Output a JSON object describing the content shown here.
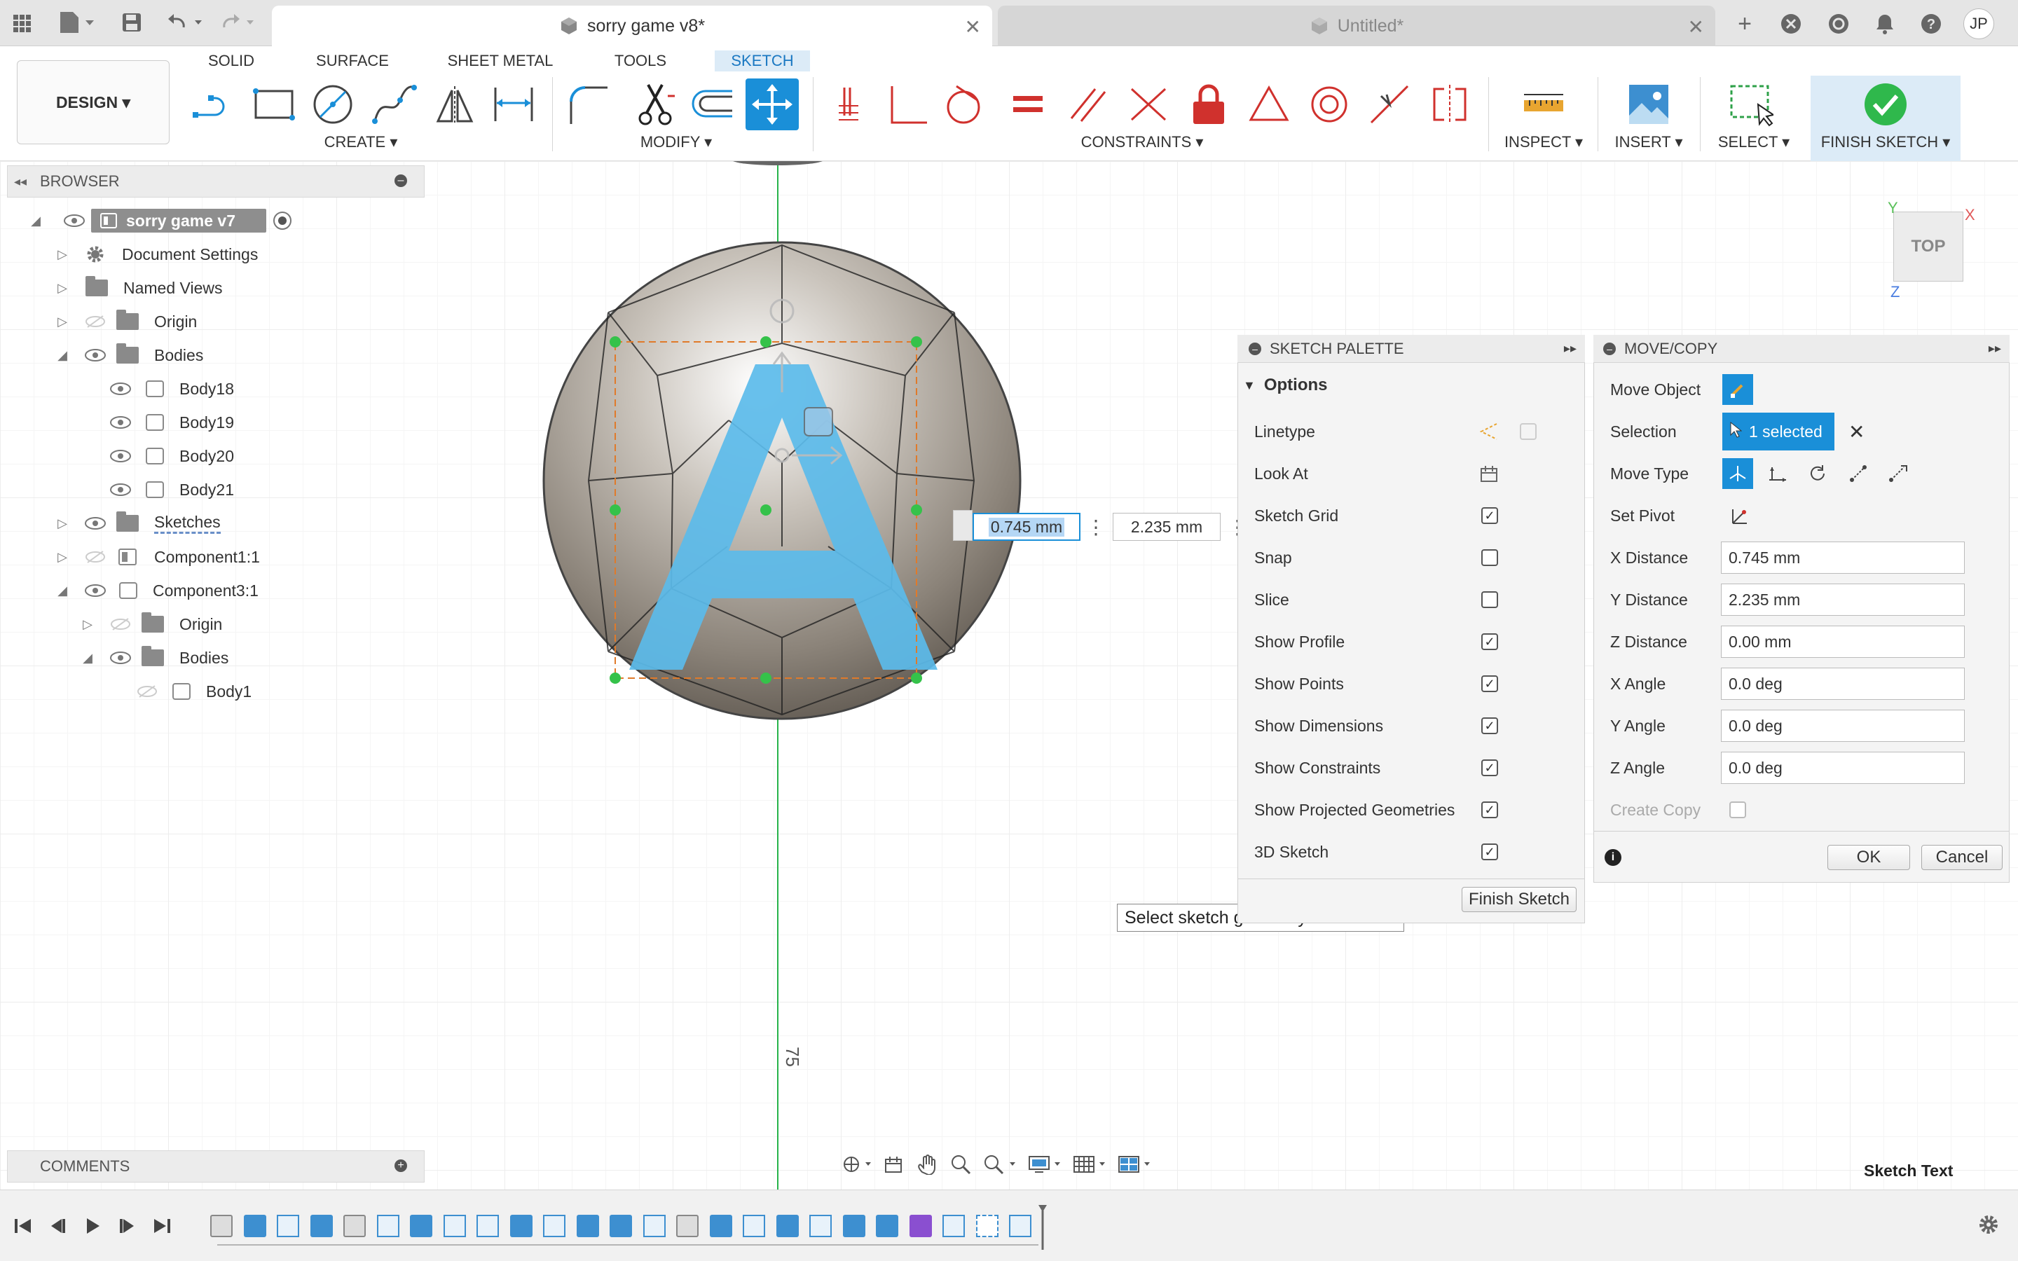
{
  "tabs": {
    "active": "sorry game v8*",
    "inactive": "Untitled*",
    "user_initials": "JP"
  },
  "workspace_tabs": [
    "SOLID",
    "SURFACE",
    "SHEET METAL",
    "TOOLS",
    "SKETCH"
  ],
  "active_workspace_tab": "SKETCH",
  "design_label": "DESIGN ▾",
  "toolbar_groups": {
    "create": "CREATE ▾",
    "modify": "MODIFY ▾",
    "constraints": "CONSTRAINTS ▾",
    "inspect": "INSPECT ▾",
    "insert": "INSERT ▾",
    "select": "SELECT ▾",
    "finish": "FINISH SKETCH ▾"
  },
  "browser": {
    "title": "BROWSER",
    "items": [
      {
        "label": "sorry game v7",
        "level": 0
      },
      {
        "label": "Document Settings",
        "level": 1
      },
      {
        "label": "Named Views",
        "level": 1
      },
      {
        "label": "Origin",
        "level": 1
      },
      {
        "label": "Bodies",
        "level": 1
      },
      {
        "label": "Body18",
        "level": 2
      },
      {
        "label": "Body19",
        "level": 2
      },
      {
        "label": "Body20",
        "level": 2
      },
      {
        "label": "Body21",
        "level": 2
      },
      {
        "label": "Sketches",
        "level": 1
      },
      {
        "label": "Component1:1",
        "level": 1
      },
      {
        "label": "Component3:1",
        "level": 1
      },
      {
        "label": "Origin",
        "level": 2
      },
      {
        "label": "Bodies",
        "level": 2
      },
      {
        "label": "Body1",
        "level": 3
      }
    ]
  },
  "comments_label": "COMMENTS",
  "viewcube_label": "TOP",
  "axis_labels": {
    "x": "X",
    "y": "Y",
    "z": "Z"
  },
  "dimension_inputs": {
    "x": "0.745 mm",
    "y": "2.235 mm"
  },
  "vertical_dimension": "75",
  "tooltip": "Select sketch geometry to move",
  "sketch_palette": {
    "title": "SKETCH PALETTE",
    "section": "Options",
    "rows": [
      {
        "label": "Linetype",
        "type": "icon"
      },
      {
        "label": "Look At",
        "type": "icon"
      },
      {
        "label": "Sketch Grid",
        "type": "check",
        "checked": true
      },
      {
        "label": "Snap",
        "type": "check",
        "checked": false
      },
      {
        "label": "Slice",
        "type": "check",
        "checked": false
      },
      {
        "label": "Show Profile",
        "type": "check",
        "checked": true
      },
      {
        "label": "Show Points",
        "type": "check",
        "checked": true
      },
      {
        "label": "Show Dimensions",
        "type": "check",
        "checked": true
      },
      {
        "label": "Show Constraints",
        "type": "check",
        "checked": true
      },
      {
        "label": "Show Projected Geometries",
        "type": "check",
        "checked": true
      },
      {
        "label": "3D Sketch",
        "type": "check",
        "checked": true
      }
    ],
    "finish_button": "Finish Sketch"
  },
  "move_copy": {
    "title": "MOVE/COPY",
    "move_object_label": "Move Object",
    "selection_label": "Selection",
    "selection_value": "1 selected",
    "move_type_label": "Move Type",
    "set_pivot_label": "Set Pivot",
    "fields": [
      {
        "label": "X Distance",
        "value": "0.745 mm"
      },
      {
        "label": "Y Distance",
        "value": "2.235 mm"
      },
      {
        "label": "Z Distance",
        "value": "0.00 mm"
      },
      {
        "label": "X Angle",
        "value": "0.0 deg"
      },
      {
        "label": "Y Angle",
        "value": "0.0 deg"
      },
      {
        "label": "Z Angle",
        "value": "0.0 deg"
      }
    ],
    "create_copy_label": "Create Copy",
    "ok_label": "OK",
    "cancel_label": "Cancel"
  },
  "status_text": "Sketch Text",
  "colors": {
    "accent": "#1a8fd8",
    "sketch_blue": "#5bbbea",
    "constraint_red": "#d0312d",
    "finish_green": "#2fb84c"
  }
}
